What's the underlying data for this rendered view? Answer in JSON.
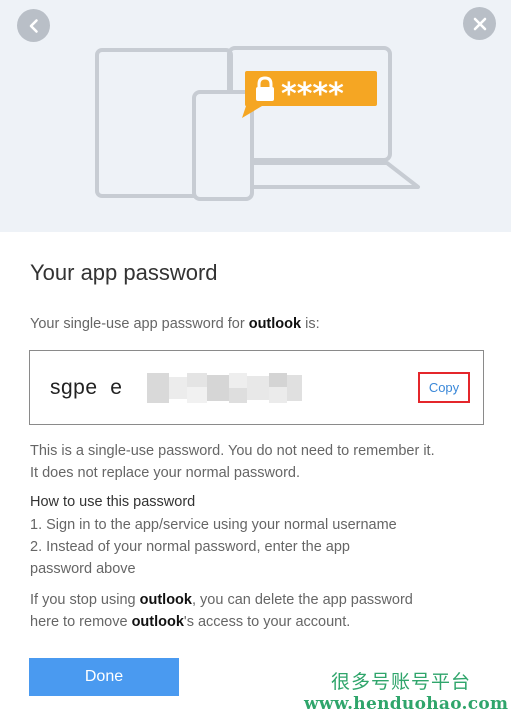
{
  "header": {
    "back_icon": "chevron-left-icon",
    "close_icon": "close-icon",
    "illustration": {
      "devices": [
        "laptop",
        "tablet",
        "phone"
      ],
      "badge_icon": "lock-icon",
      "badge_text": "****",
      "badge_color": "#f5a623"
    }
  },
  "dialog": {
    "title": "Your app password",
    "subtitle_prefix": "Your single-use app password for ",
    "app_name": "outlook",
    "subtitle_suffix": " is:",
    "password_visible": "sgpe  e",
    "copy_label": "Copy",
    "note_line1": "This is a single-use password. You do not need to remember it.",
    "note_line2": "It does not replace your normal password.",
    "howto_heading": "How to use this password",
    "step1": "1. Sign in to the app/service using your normal username",
    "step2_line1": "2. Instead of your normal password, enter the app",
    "step2_line2": "password above",
    "stop_prefix": "If you stop using ",
    "stop_app": "outlook",
    "stop_middle": ", you can delete the app password",
    "stop_line2_prefix": "here to remove ",
    "stop_line2_app": "outlook",
    "stop_line2_suffix": "'s access to your account.",
    "done_label": "Done"
  },
  "watermark": {
    "cn_text": "很多号账号平台",
    "url_text": "www.henduohao.com"
  },
  "colors": {
    "accent_blue": "#4a9af0",
    "copy_highlight": "#e4262b",
    "badge_orange": "#f5a623",
    "watermark_green": "#2fa56b"
  }
}
